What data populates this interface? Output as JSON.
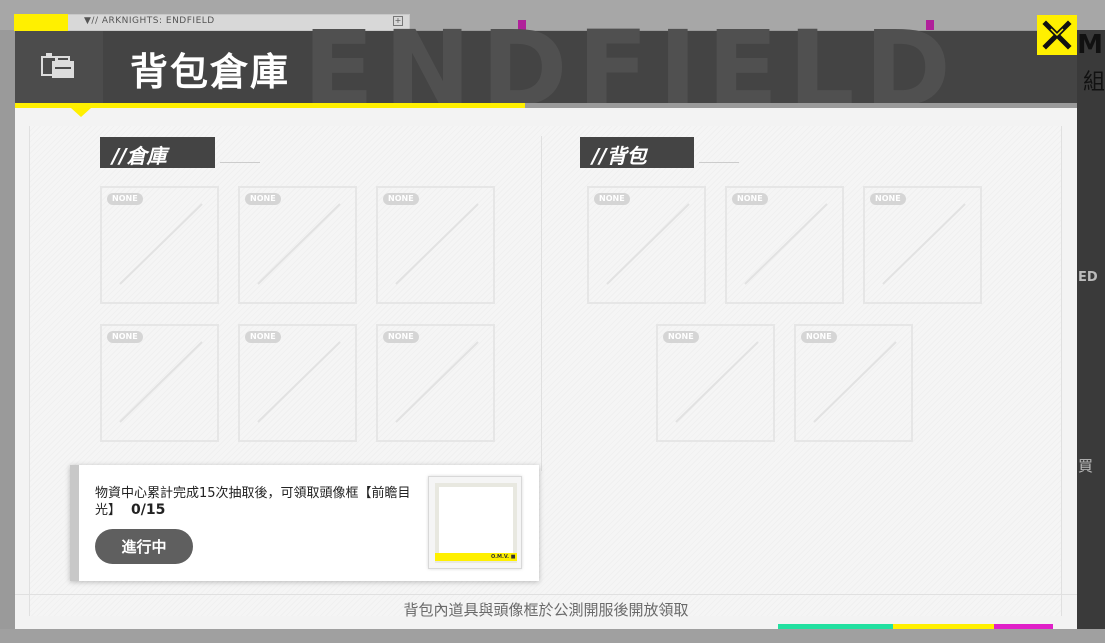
{
  "background": {
    "tab_label": "▼// ARKNIGHTS: ENDFIELD",
    "tab_plus": "+",
    "right_text": "M",
    "right_text2": "組",
    "right_side_text": "ED",
    "right_side_text2": "買"
  },
  "header": {
    "title": "背包倉庫",
    "watermark": "ENDFIELD",
    "icon": "backpack-warehouse-icon"
  },
  "close": {
    "label": "✕",
    "icon": "close-icon"
  },
  "warehouse": {
    "title": "//倉庫",
    "slots": [
      {
        "badge": "NONE"
      },
      {
        "badge": "NONE"
      },
      {
        "badge": "NONE"
      },
      {
        "badge": "NONE"
      },
      {
        "badge": "NONE"
      },
      {
        "badge": "NONE"
      }
    ]
  },
  "backpack": {
    "title": "//背包",
    "slots": [
      {
        "badge": "NONE"
      },
      {
        "badge": "NONE"
      },
      {
        "badge": "NONE"
      },
      {
        "badge": "NONE"
      },
      {
        "badge": "NONE"
      }
    ]
  },
  "mission": {
    "text": "物資中心累計完成15次抽取後，可領取頭像框【前瞻目光】",
    "progress": "0/15",
    "button_label": "進行中",
    "frame_tag": "O.M.V. ■"
  },
  "footer": {
    "note": "背包內道具與頭像框於公測開服後開放領取"
  },
  "colors": {
    "accent_yellow": "#fff000",
    "header_dark": "#444444",
    "accent_green": "#22e0a0",
    "accent_magenta": "#e020c8"
  }
}
